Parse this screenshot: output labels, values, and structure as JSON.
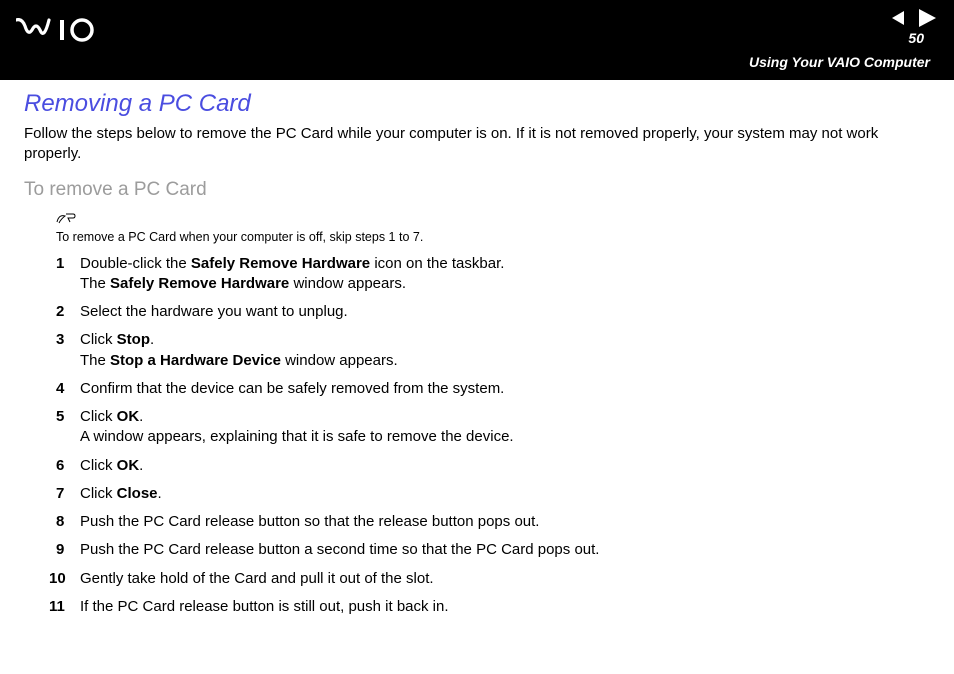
{
  "header": {
    "page_number": "50",
    "section": "Using Your VAIO Computer"
  },
  "heading": "Removing a PC Card",
  "intro": "Follow the steps below to remove the PC Card while your computer is on. If it is not removed properly, your system may not work properly.",
  "subheading": "To remove a PC Card",
  "note": "To remove a PC Card when your computer is off, skip steps 1 to 7.",
  "steps": {
    "s1a": "Double-click the ",
    "s1b": "Safely Remove Hardware",
    "s1c": " icon on the taskbar.",
    "s1d": "The ",
    "s1e": "Safely Remove Hardware",
    "s1f": " window appears.",
    "s2": "Select the hardware you want to unplug.",
    "s3a": "Click ",
    "s3b": "Stop",
    "s3c": ".",
    "s3d": "The ",
    "s3e": "Stop a Hardware Device",
    "s3f": " window appears.",
    "s4": "Confirm that the device can be safely removed from the system.",
    "s5a": "Click ",
    "s5b": "OK",
    "s5c": ".",
    "s5d": "A window appears, explaining that it is safe to remove the device.",
    "s6a": "Click ",
    "s6b": "OK",
    "s6c": ".",
    "s7a": "Click ",
    "s7b": "Close",
    "s7c": ".",
    "s8": "Push the PC Card release button so that the release button pops out.",
    "s9": "Push the PC Card release button a second time so that the PC Card pops out.",
    "s10": "Gently take hold of the Card and pull it out of the slot.",
    "s11": "If the PC Card release button is still out, push it back in."
  }
}
